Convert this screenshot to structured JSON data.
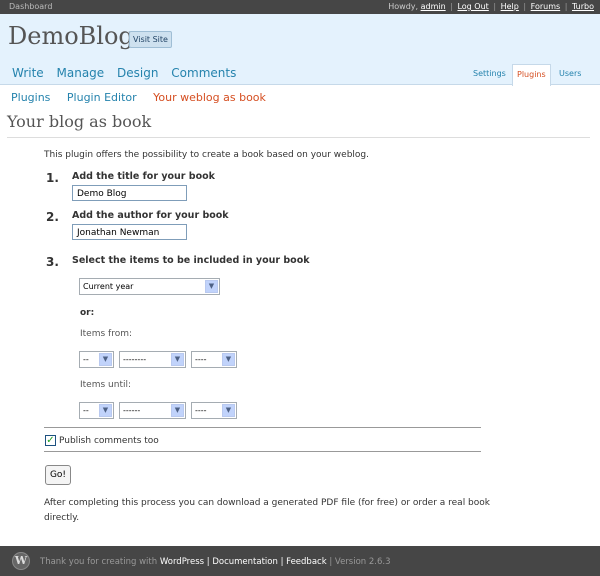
{
  "topbar": {
    "dashboard": "Dashboard",
    "howdy": "Howdy,",
    "user": "admin",
    "links": [
      "Log Out",
      "Help",
      "Forums",
      "Turbo"
    ]
  },
  "header": {
    "blog_title": "DemoBlog",
    "visit_site": "Visit Site",
    "main_nav": [
      "Write",
      "Manage",
      "Design",
      "Comments"
    ],
    "sub_tabs": [
      "Settings",
      "Plugins",
      "Users"
    ],
    "active_tab": "Plugins"
  },
  "submenu": {
    "items": [
      "Plugins",
      "Plugin Editor",
      "Your weblog as book"
    ],
    "current": "Your weblog as book"
  },
  "page": {
    "title": "Your blog as book",
    "intro": "This plugin offers the possibility to create a book based on your weblog.",
    "step1": {
      "num": "1.",
      "label": "Add the title for your book",
      "value": "Demo Blog"
    },
    "step2": {
      "num": "2.",
      "label": "Add the author for your book",
      "value": "Jonathan Newman"
    },
    "step3": {
      "num": "3.",
      "label": "Select the items to be included in your book"
    },
    "period_select": "Current year",
    "or_label": "or:",
    "items_from_label": "Items from:",
    "items_until_label": "Items until:",
    "from": {
      "day": "--",
      "month": "--------",
      "year": "----"
    },
    "until": {
      "day": "--",
      "month": "------",
      "year": "----"
    },
    "publish_comments": "Publish comments too",
    "publish_comments_checked": true,
    "go_button": "Go!",
    "after_text": "After completing this process you can download a generated PDF file (for free) or order a real book directly."
  },
  "footer": {
    "logo_letter": "W",
    "thanks": "Thank you for creating with",
    "wordpress": "WordPress",
    "documentation": "Documentation",
    "feedback": "Feedback",
    "version": "Version 2.6.3"
  },
  "colors": {
    "topbar": "#464646",
    "header": "#e4f2fd",
    "link": "#2583ad",
    "active": "#d54e21"
  }
}
